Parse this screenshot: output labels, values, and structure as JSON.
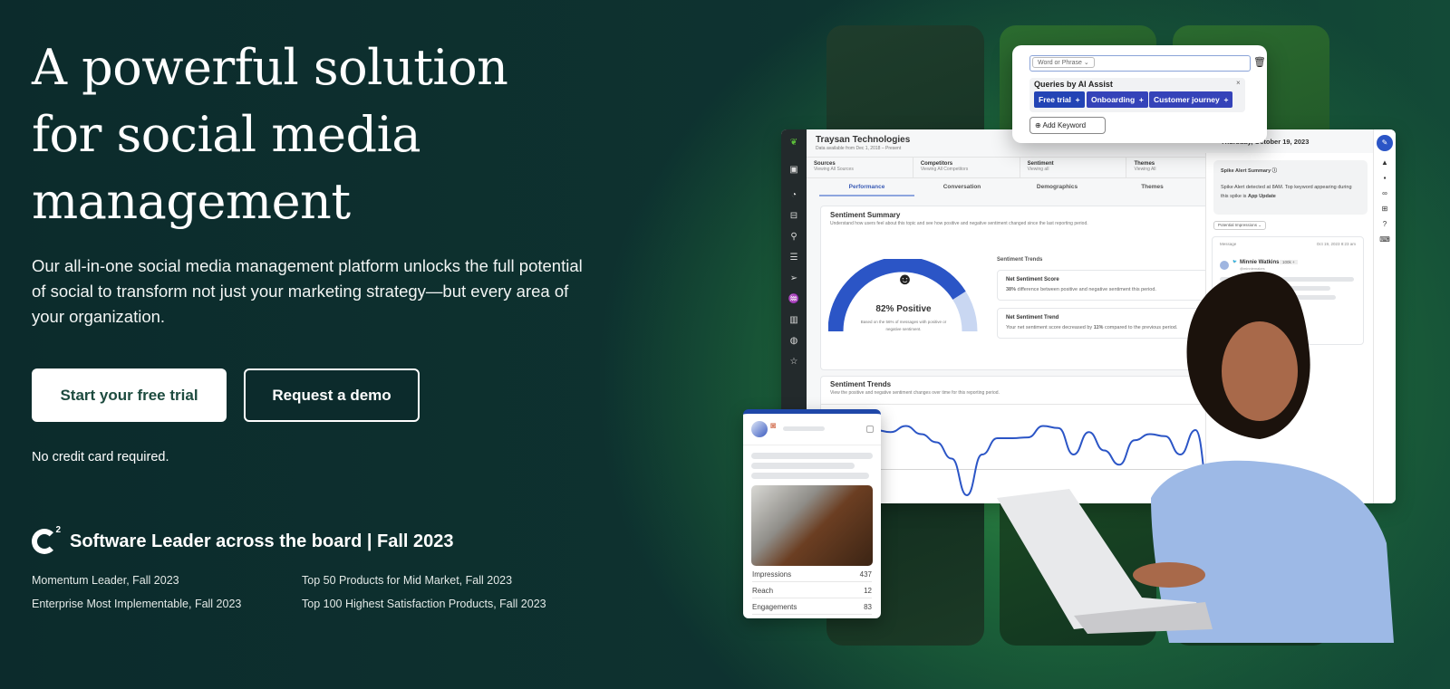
{
  "hero": {
    "title_lines": [
      "A powerful solution",
      "for social media",
      "management"
    ],
    "lead": "Our all-in-one social media management platform unlocks the full potential of social to transform not just your marketing strategy—but every area of your organization.",
    "primary_cta": "Start your free trial",
    "secondary_cta": "Request a demo",
    "note": "No credit card required."
  },
  "awards": {
    "logo": "G2",
    "headline": "Software Leader across the board | Fall 2023",
    "items": [
      "Momentum Leader, Fall 2023",
      "Top 50 Products for Mid Market, Fall 2023",
      "Enterprise Most Implementable, Fall 2023",
      "Top 100 Highest Satisfaction Products, Fall 2023"
    ]
  },
  "keyword_popup": {
    "select": "Word or Phrase",
    "ai_title": "Queries by AI Assist",
    "chips": [
      "Free trial",
      "Onboarding",
      "Customer journey"
    ],
    "add_keyword": "Add Keyword"
  },
  "dashboard": {
    "company": "Traysan Technologies",
    "subtitle": "Data available from Dec 1, 2018 – Present",
    "date": "Thursday, October 19, 2023",
    "filters": [
      {
        "label": "Sources",
        "value": "Viewing All Sources"
      },
      {
        "label": "Competitors",
        "value": "Viewing All Competitors"
      },
      {
        "label": "Sentiment",
        "value": "Viewing all"
      },
      {
        "label": "Themes",
        "value": "Viewing All"
      }
    ],
    "tabs": [
      "Performance",
      "Conversation",
      "Demographics",
      "Themes"
    ],
    "active_tab": "Performance",
    "summary_title": "Sentiment Summary",
    "summary_desc": "Understand how users feel about this topic and see how positive and negative sentiment changed since the last reporting period.",
    "gauge_label": "82% Positive",
    "gauge_value": 82,
    "gauge_note": "Based on the 56% of messages with positive or negative sentiment.",
    "trends_heading": "Sentiment Trends",
    "score_title": "Net Sentiment Score",
    "score_bold": "38%",
    "score_text": " difference between positive and negative sentiment this period.",
    "trend_title": "Net Sentiment Trend",
    "trend_text_a": "Your net sentiment score decreased by ",
    "trend_bold": "11%",
    "trend_text_b": " compared to the previous period.",
    "trends_title": "Sentiment Trends",
    "trends_desc": "View the positive and negative sentiment changes over time for this reporting period.",
    "trend_series": [
      0.8,
      0.75,
      0.9,
      0.7,
      0.5,
      0.1,
      -0.8,
      0.2,
      0.6,
      0.6,
      0.62,
      0.9,
      0.85,
      0.2,
      0.75,
      0.3,
      -0.05,
      0.55,
      0.7,
      0.65,
      0.2,
      0.8,
      -0.9
    ],
    "accent": "#2b55c6",
    "spike_title": "Spike Alert Summary",
    "spike_text": "Spike Alert detected at 8AM. Top keyword appearing during this spike is ",
    "spike_bold": "App Update",
    "impressions_select": "Potential Impressions",
    "msg_label": "Message",
    "msg_time": "Oct 19, 2023 8:23 am",
    "author": "Minnie Watkins",
    "handle": "@minniemakes",
    "followers": "100k +"
  },
  "social_card": {
    "stats": [
      {
        "label": "Impressions",
        "value": "437"
      },
      {
        "label": "Reach",
        "value": "12"
      },
      {
        "label": "Engagements",
        "value": "83"
      }
    ]
  }
}
